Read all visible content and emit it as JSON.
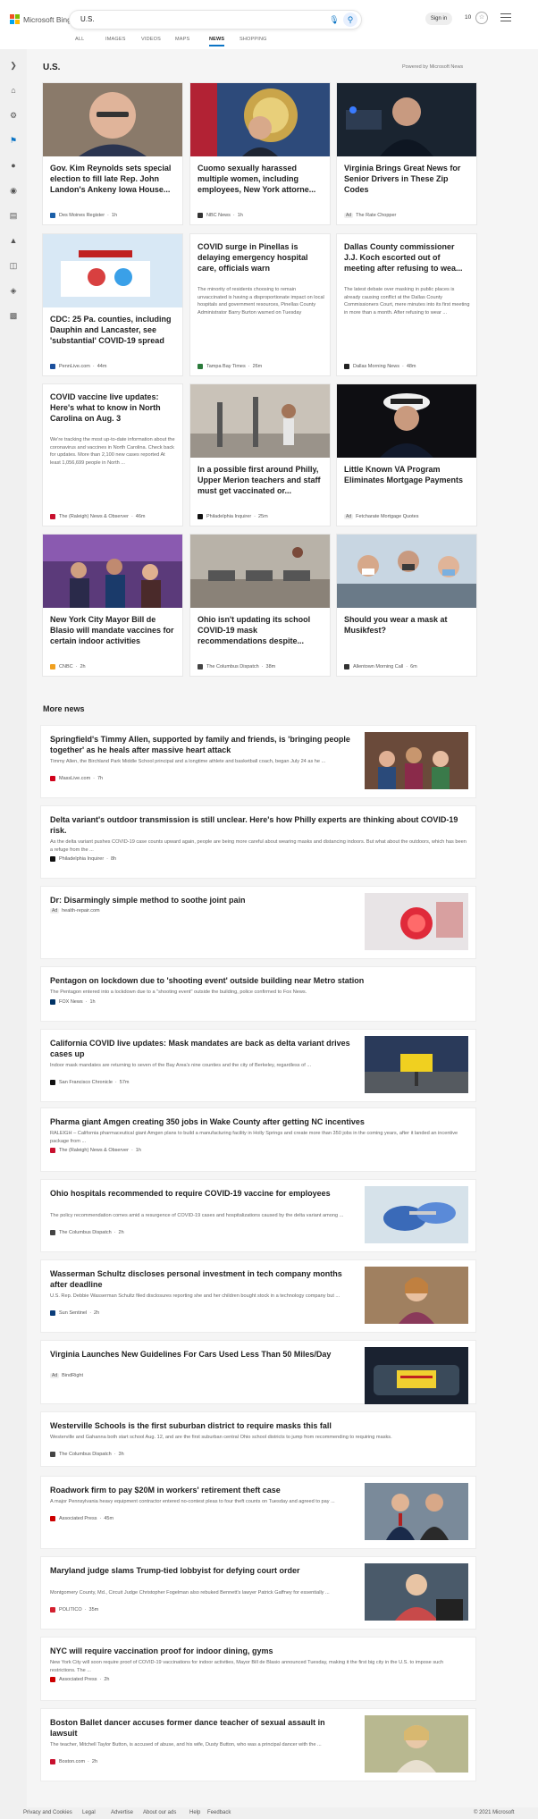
{
  "header": {
    "logo_text": "Microsoft Bing",
    "search_value": "U.S.",
    "signin_label": "Sign in",
    "reward_count": "10"
  },
  "tabs": [
    "ALL",
    "IMAGES",
    "VIDEOS",
    "MAPS",
    "NEWS",
    "SHOPPING"
  ],
  "active_tab": "NEWS",
  "page_title": "U.S.",
  "powered_by": "Powered by Microsoft News",
  "cards": [
    {
      "title": "Gov. Kim Reynolds sets special election to fill late Rep. John Landon's Ankeny Iowa House...",
      "snippet": "",
      "source": "Des Moines Register",
      "time": "1h",
      "ad": "",
      "fav": "#1b5fa8",
      "img": "man-glasses"
    },
    {
      "title": "Cuomo sexually harassed multiple women, including employees, New York attorne...",
      "snippet": "",
      "source": "NBC News",
      "time": "1h",
      "ad": "",
      "fav": "#333333",
      "img": "podium"
    },
    {
      "title": "Virginia Brings Great News for Senior Drivers in These Zip Codes",
      "snippet": "",
      "source": "The Rate Chopper",
      "time": "",
      "ad": "Ad",
      "fav": "#777777",
      "img": "police"
    },
    {
      "title": "CDC: 25 Pa. counties, including Dauphin and Lancaster, see 'substantial' COVID-19 spread",
      "snippet": "",
      "source": "PennLive.com",
      "time": "44m",
      "ad": "",
      "fav": "#1b4f9c",
      "img": "vaccine"
    },
    {
      "title": "COVID surge in Pinellas is delaying emergency hospital care, officials warn",
      "snippet": "The minority of residents choosing to remain unvaccinated is having a disproportionate impact on local hospitals and government resources, Pinellas County Administrator Barry Burton warned on Tuesday",
      "source": "Tampa Bay Times",
      "time": "26m",
      "ad": "",
      "fav": "#2a7a3a",
      "img": ""
    },
    {
      "title": "Dallas County commissioner J.J. Koch escorted out of meeting after refusing to wea...",
      "snippet": "The latest debate over masking in public places is already causing conflict at the Dallas County Commissioners Court, mere minutes into its first meeting in more than a month. After refusing to wear ...",
      "source": "Dallas Morning News",
      "time": "48m",
      "ad": "",
      "fav": "#222222",
      "img": ""
    },
    {
      "title": "COVID vaccine live updates: Here's what to know in North Carolina on Aug. 3",
      "snippet": "We're tracking the most up-to-date information about the coronavirus and vaccines in North Carolina. Check back for updates. More than 2,100 new cases reported At least 1,056,699 people in North ...",
      "source": "The (Raleigh) News & Observer",
      "time": "46m",
      "ad": "",
      "fav": "#c8102e",
      "img": ""
    },
    {
      "title": "In a possible first around Philly, Upper Merion teachers and staff must get vaccinated or...",
      "snippet": "",
      "source": "Philadelphia Inquirer",
      "time": "25m",
      "ad": "",
      "fav": "#111111",
      "img": "hallway"
    },
    {
      "title": "Little Known VA Program Eliminates Mortgage Payments",
      "snippet": "",
      "source": "Fetcharate Mortgage Quotes",
      "time": "",
      "ad": "Ad",
      "fav": "#777777",
      "img": "navy"
    },
    {
      "title": "New York City Mayor Bill de Blasio will mandate vaccines for certain indoor activities",
      "snippet": "",
      "source": "CNBC",
      "time": "2h",
      "ad": "",
      "fav": "#f0a020",
      "img": "crowd"
    },
    {
      "title": "Ohio isn't updating its school COVID-19 mask recommendations despite...",
      "snippet": "",
      "source": "The Columbus Dispatch",
      "time": "38m",
      "ad": "",
      "fav": "#444444",
      "img": "classroom"
    },
    {
      "title": "Should you wear a mask at Musikfest?",
      "snippet": "",
      "source": "Allentown Morning Call",
      "time": "6m",
      "ad": "",
      "fav": "#333333",
      "img": "masks"
    }
  ],
  "more_news_title": "More news",
  "more_news": [
    {
      "title": "Springfield's Timmy Allen, supported by family and friends, is 'bringing people together' as he heals after massive heart attack",
      "snippet": "Timmy Allen, the Birchland Park Middle School principal and a longtime athlete and basketball coach, began July 24 as he ...",
      "source": "MassLive.com",
      "time": "7h",
      "ad": "",
      "fav": "#d0021b",
      "img": "family"
    },
    {
      "title": "Delta variant's outdoor transmission is still unclear. Here's how Philly experts are thinking about COVID-19 risk.",
      "snippet": "As the delta variant pushes COVID-19 case counts upward again, people are being more careful about wearing masks and distancing indoors. But what about the outdoors, which has been a refuge from the ...",
      "source": "Philadelphia Inquirer",
      "time": "8h",
      "ad": "",
      "fav": "#111111",
      "img": ""
    },
    {
      "title": "Dr: Disarmingly simple method to soothe joint pain",
      "snippet": "",
      "source": "health-repair.com",
      "time": "",
      "ad": "Ad",
      "fav": "",
      "img": "gummy"
    },
    {
      "title": "Pentagon on lockdown due to 'shooting event' outside building near Metro station",
      "snippet": "The Pentagon entered into a lockdown due to a \"shooting event\" outside the building, police confirmed to Fox News.",
      "source": "FOX News",
      "time": "1h",
      "ad": "",
      "fav": "#003366",
      "img": ""
    },
    {
      "title": "California COVID live updates: Mask mandates are back as delta variant drives cases up",
      "snippet": "Indoor mask mandates are returning to seven of the Bay Area's nine counties and the city of Berkeley, regardless of ...",
      "source": "San Francisco Chronicle",
      "time": "57m",
      "ad": "",
      "fav": "#111111",
      "img": "sign"
    },
    {
      "title": "Pharma giant Amgen creating 350 jobs in Wake County after getting NC incentives",
      "snippet": "RALEIGH – California pharmaceutical giant Amgen plans to build a manufacturing facility in Holly Springs and create more than 350 jobs in the coming years, after it landed an incentive package from ...",
      "source": "The (Raleigh) News & Observer",
      "time": "1h",
      "ad": "",
      "fav": "#c8102e",
      "img": ""
    },
    {
      "title": "Ohio hospitals recommended to require COVID-19 vaccine for employees",
      "snippet": "The policy recommendation comes amid a resurgence of COVID-19 cases and hospitalizations caused by the delta variant among ...",
      "source": "The Columbus Dispatch",
      "time": "2h",
      "ad": "",
      "fav": "#444444",
      "img": "gloves"
    },
    {
      "title": "Wasserman Schultz discloses personal investment in tech company months after deadline",
      "snippet": "U.S. Rep. Debbie Wasserman Schultz filed disclosures reporting she and her children bought stock in a technology company but ...",
      "source": "Sun Sentinel",
      "time": "2h",
      "ad": "",
      "fav": "#0a3d7a",
      "img": "woman"
    },
    {
      "title": "Virginia Launches New Guidelines For Cars Used Less Than 50 Miles/Day",
      "snippet": "",
      "source": "BindRight",
      "time": "",
      "ad": "Ad",
      "fav": "",
      "img": "car"
    },
    {
      "title": "Westerville Schools is the first suburban district to require masks this fall",
      "snippet": "Westerville and Gahanna both start school Aug. 12, and are the first suburban central Ohio school districts to jump from recommending to requiring masks.",
      "source": "The Columbus Dispatch",
      "time": "3h",
      "ad": "",
      "fav": "#444444",
      "img": ""
    },
    {
      "title": "Roadwork firm to pay $20M in workers' retirement theft case",
      "snippet": "A major Pennsylvania heavy equipment contractor entered no-contest pleas to four theft counts on Tuesday and agreed to pay ...",
      "source": "Associated Press",
      "time": "45m",
      "ad": "",
      "fav": "#cc0000",
      "img": "suits"
    },
    {
      "title": "Maryland judge slams Trump-tied lobbyist for defying court order",
      "snippet": "Montgomery County, Md., Circuit Judge Christopher Fogelman also rebuked Bennett's lawyer Patrick Gaffney for essentially ...",
      "source": "POLITICO",
      "time": "35m",
      "ad": "",
      "fav": "#d3202f",
      "img": "speaker"
    },
    {
      "title": "NYC will require vaccination proof for indoor dining, gyms",
      "snippet": "New York City will soon require proof of COVID-19 vaccinations for indoor activities, Mayor Bill de Blasio announced Tuesday, making it the first big city in the U.S. to impose such restrictions. The ...",
      "source": "Associated Press",
      "time": "2h",
      "ad": "",
      "fav": "#cc0000",
      "img": ""
    },
    {
      "title": "Boston Ballet dancer accuses former dance teacher of sexual assault in lawsuit",
      "snippet": "The teacher, Mitchell Taylor Button, is accused of abuse, and his wife, Dusty Button, who was a principal dancer with the ...",
      "source": "Boston.com",
      "time": "2h",
      "ad": "",
      "fav": "#c8102e",
      "img": "ballet"
    }
  ],
  "footer": {
    "links": [
      "Privacy and Cookies",
      "Legal",
      "Advertise",
      "About our ads",
      "Help",
      "Feedback"
    ],
    "copyright": "© 2021 Microsoft"
  }
}
